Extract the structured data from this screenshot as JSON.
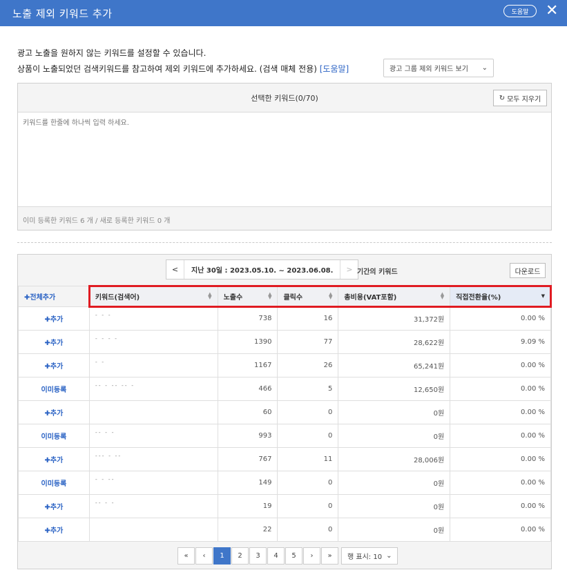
{
  "modal": {
    "title": "노출 제외 키워드 추가",
    "help_label": "도움말",
    "close_label": "✕"
  },
  "desc": {
    "line1": "광고 노출을 원하지 않는 키워드를 설정할 수 있습니다.",
    "line2": "상품이 노출되었던 검색키워드를 참고하여 제외 키워드에 추가하세요. (검색 매체 전용)",
    "help_link": "[도움말]",
    "group_select": "광고 그룹 제외 키워드 보기"
  },
  "keyword_panel": {
    "header": "선택한 키워드(0/70)",
    "clear_label": "모두 지우기",
    "placeholder": "키워드를 한줄에 하나씩 입력 하세요.",
    "footer": "이미 등록한 키워드 6 개  /  새로 등록한 키워드 0 개"
  },
  "period": {
    "prev": "<",
    "label": "지난 30일 : 2023.05.10. ~ 2023.06.08.",
    "next": ">",
    "suffix": "기간의 키워드",
    "download": "다운로드"
  },
  "table": {
    "add_all": "✚전체추가",
    "columns": [
      "키워드(검색어)",
      "노출수",
      "클릭수",
      "총비용(VAT포함)",
      "직접전환율(%)"
    ],
    "rows": [
      {
        "action": "✚추가",
        "keyword": "- - -",
        "impressions": "738",
        "clicks": "16",
        "cost": "31,372원",
        "cvr": "0.00 %"
      },
      {
        "action": "✚추가",
        "keyword": "-  -  -  -",
        "impressions": "1390",
        "clicks": "77",
        "cost": "28,622원",
        "cvr": "9.09 %"
      },
      {
        "action": "✚추가",
        "keyword": "- -",
        "impressions": "1167",
        "clicks": "26",
        "cost": "65,241원",
        "cvr": "0.00 %"
      },
      {
        "action": "이미등록",
        "keyword": "-- - -- -- -",
        "impressions": "466",
        "clicks": "5",
        "cost": "12,650원",
        "cvr": "0.00 %"
      },
      {
        "action": "✚추가",
        "keyword": "",
        "impressions": "60",
        "clicks": "0",
        "cost": "0원",
        "cvr": "0.00 %"
      },
      {
        "action": "이미등록",
        "keyword": "-- - -",
        "impressions": "993",
        "clicks": "0",
        "cost": "0원",
        "cvr": "0.00 %"
      },
      {
        "action": "✚추가",
        "keyword": "--- - --",
        "impressions": "767",
        "clicks": "11",
        "cost": "28,006원",
        "cvr": "0.00 %"
      },
      {
        "action": "이미등록",
        "keyword": "- - --",
        "impressions": "149",
        "clicks": "0",
        "cost": "0원",
        "cvr": "0.00 %"
      },
      {
        "action": "✚추가",
        "keyword": "-- - -",
        "impressions": "19",
        "clicks": "0",
        "cost": "0원",
        "cvr": "0.00 %"
      },
      {
        "action": "✚추가",
        "keyword": "",
        "impressions": "22",
        "clicks": "0",
        "cost": "0원",
        "cvr": "0.00 %"
      }
    ]
  },
  "pagination": {
    "first": "«",
    "prev": "‹",
    "pages": [
      "1",
      "2",
      "3",
      "4",
      "5"
    ],
    "next": "›",
    "last": "»",
    "rows_label": "행 표시: 10",
    "current": "1"
  },
  "colors": {
    "header_blue": "#3f76c9",
    "link_blue": "#2a62c4",
    "highlight_red": "#e01b22"
  }
}
